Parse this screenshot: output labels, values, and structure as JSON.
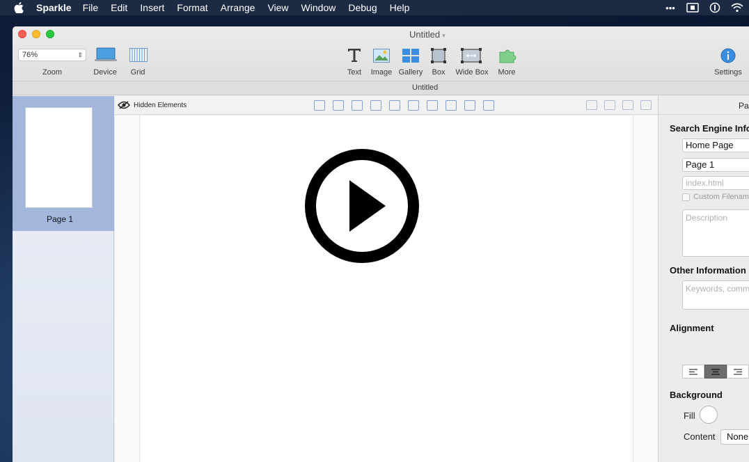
{
  "menubar": {
    "app_name": "Sparkle",
    "items": [
      "File",
      "Edit",
      "Insert",
      "Format",
      "Arrange",
      "View",
      "Window",
      "Debug",
      "Help"
    ],
    "right_icons": [
      "more-icon",
      "screen-record-icon",
      "info-circle-icon",
      "wifi-icon"
    ]
  },
  "window": {
    "title": "Untitled",
    "document_name": "Untitled"
  },
  "toolbar": {
    "zoom_value": "76%",
    "zoom_label": "Zoom",
    "device_label": "Device",
    "grid_label": "Grid",
    "text_label": "Text",
    "image_label": "Image",
    "gallery_label": "Gallery",
    "box_label": "Box",
    "widebox_label": "Wide Box",
    "more_label": "More",
    "settings_label": "Settings"
  },
  "pages": [
    {
      "name": "Page 1",
      "selected": true
    }
  ],
  "editor": {
    "hidden_elements_label": "Hidden Elements"
  },
  "inspector": {
    "tab_label": "Pa",
    "search_engine_heading": "Search Engine Info",
    "page_type": "Home Page",
    "page_title": "Page 1",
    "filename_placeholder": "index.html",
    "custom_filename_label": "Custom Filename",
    "description_placeholder": "Description",
    "other_info_heading": "Other Information",
    "keywords_placeholder": "Keywords, comm",
    "alignment_heading": "Alignment",
    "alignment_selected": "center",
    "background_heading": "Background",
    "fill_label": "Fill",
    "content_label": "Content",
    "content_value": "None"
  },
  "colors": {
    "page_selection": "#a3b7dd",
    "accent_blue": "#5b86c9",
    "close": "#ff5f57",
    "minimize": "#febc2e",
    "maximize": "#28c840"
  }
}
